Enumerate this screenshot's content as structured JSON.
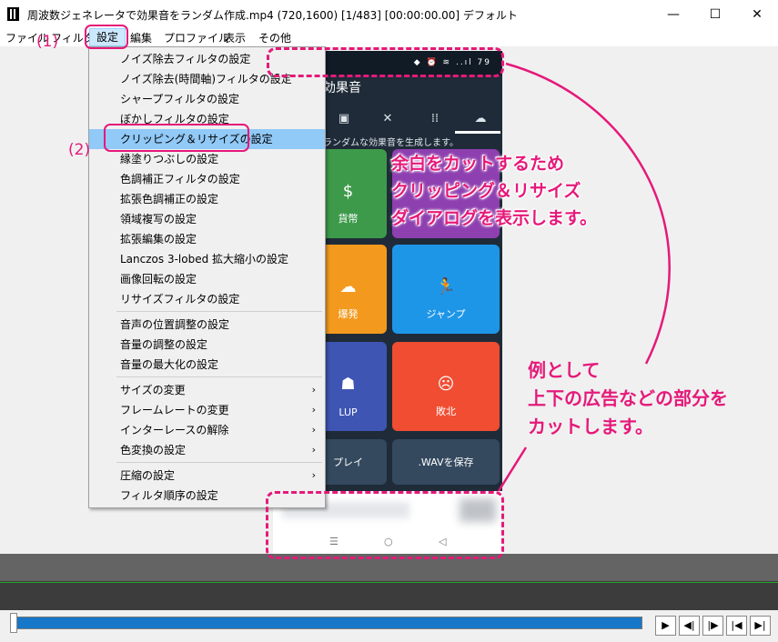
{
  "window": {
    "title": "周波数ジェネレータで効果音をランダム作成.mp4 (720,1600)  [1/483] [00:00:00.00]  デフォルト",
    "controls": {
      "minimize": "—",
      "maximize": "☐",
      "close": "✕"
    }
  },
  "menubar": {
    "items": [
      {
        "label": "ファイル"
      },
      {
        "label": "フィルタ"
      },
      {
        "label": "設定"
      },
      {
        "label": "編集"
      },
      {
        "label": "プロファイル"
      },
      {
        "label": "表示"
      },
      {
        "label": "その他"
      }
    ]
  },
  "dropdown": {
    "items": [
      {
        "label": "ノイズ除去フィルタの設定"
      },
      {
        "label": "ノイズ除去(時間軸)フィルタの設定"
      },
      {
        "label": "シャープフィルタの設定"
      },
      {
        "label": "ぼかしフィルタの設定"
      },
      {
        "label": "クリッピング＆リサイズの設定"
      },
      {
        "label": "縁塗りつぶしの設定"
      },
      {
        "label": "色調補正フィルタの設定"
      },
      {
        "label": "拡張色調補正の設定"
      },
      {
        "label": "領域複写の設定"
      },
      {
        "label": "拡張編集の設定"
      },
      {
        "label": "Lanczos 3-lobed 拡大縮小の設定"
      },
      {
        "label": "画像回転の設定"
      },
      {
        "label": "リサイズフィルタの設定"
      },
      {
        "label": "音声の位置調整の設定"
      },
      {
        "label": "音量の調整の設定"
      },
      {
        "label": "音量の最大化の設定"
      },
      {
        "label": "サイズの変更"
      },
      {
        "label": "フレームレートの変更"
      },
      {
        "label": "インターレースの解除"
      },
      {
        "label": "色変換の設定"
      },
      {
        "label": "圧縮の設定"
      },
      {
        "label": "フィルタ順序の設定"
      }
    ],
    "submenu_arrow": "›"
  },
  "phone": {
    "status_icons": "◆ ⏰ ≋ ..ıl 79",
    "app_title": "効果音",
    "tab_icons": {
      "speaker": "▣",
      "mute": "✕",
      "grid": "⁞⁞",
      "explosion": "☁"
    },
    "description": "ランダムな効果音を生成します。",
    "tiles": [
      {
        "label": "貨幣",
        "icon": "$",
        "color": "#3d9a4a"
      },
      {
        "label": "",
        "icon": "",
        "color": "#8e3fb0"
      },
      {
        "label": "爆発",
        "icon": "☁",
        "color": "#f39a1e"
      },
      {
        "label": "ジャンプ",
        "icon": "🏃",
        "color": "#1e96e8"
      },
      {
        "label": "LUP",
        "icon": "☗",
        "color": "#3e55b4"
      },
      {
        "label": "敗北",
        "icon": "☹",
        "color": "#f04d32"
      },
      {
        "label": "プレイ",
        "icon": "",
        "color": "#34495e"
      },
      {
        "label": ".WAVを保存",
        "icon": "",
        "color": "#34495e"
      }
    ],
    "nav": {
      "menu": "☰",
      "home": "○",
      "back": "◁"
    }
  },
  "player": {
    "buttons": {
      "play": "▶",
      "prev_frame": "◀|",
      "next_frame": "|▶",
      "first": "|◀",
      "last": "▶|"
    }
  },
  "annotations": {
    "label1": "(1)",
    "label2": "(2)",
    "callout1": [
      "余白をカットするため",
      "クリッピング＆リサイズ",
      "ダイアログを表示します。"
    ],
    "callout2": [
      "例として",
      "上下の広告などの部分を",
      "カットします。"
    ],
    "color": "#e5197a"
  }
}
